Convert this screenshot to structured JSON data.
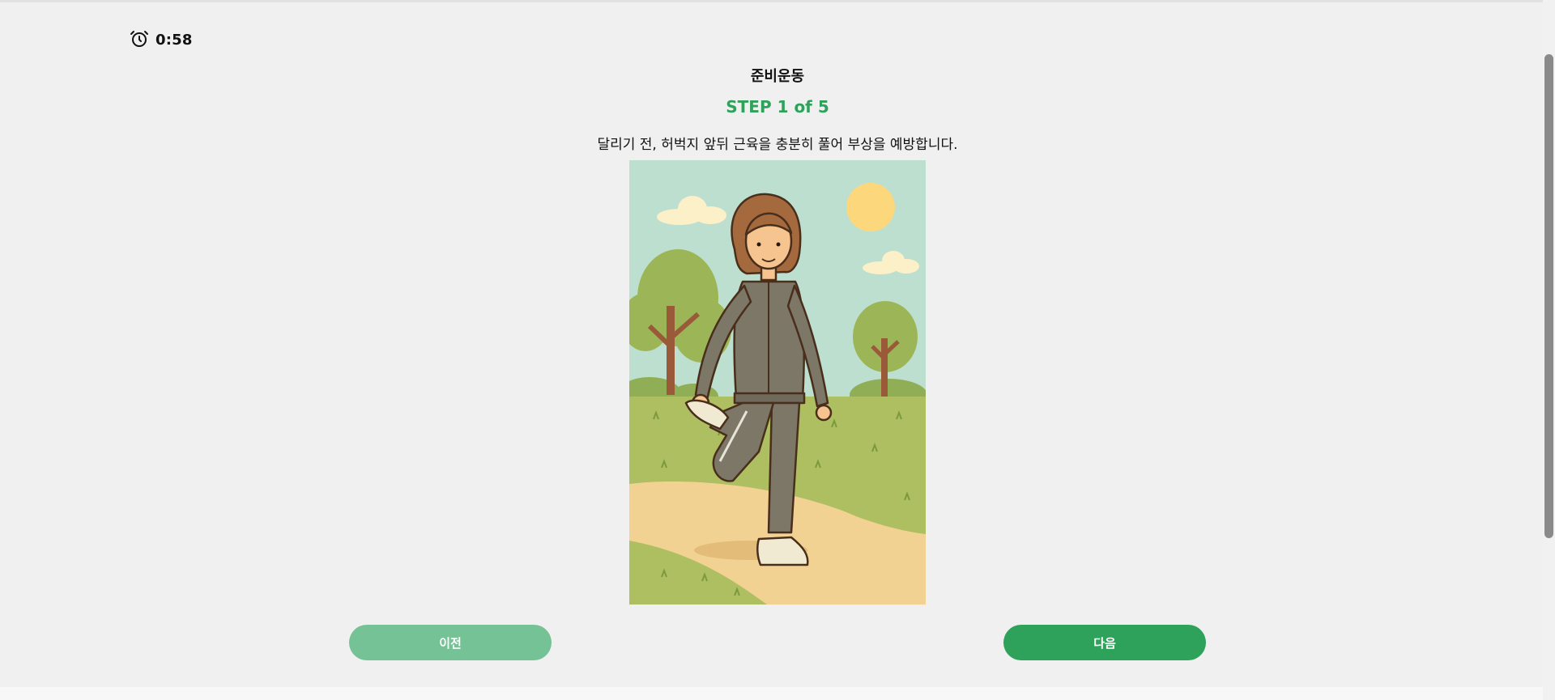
{
  "timer": {
    "icon": "alarm-clock-icon",
    "value": "0:58"
  },
  "header": {
    "title": "준비운동",
    "step_label": "STEP 1 of 5",
    "description": "달리기 전, 허벅지 앞뒤 근육을 충분히 풀어 부상을 예방합니다."
  },
  "illustration": {
    "subject": "woman-stretching-quadriceps-in-park"
  },
  "navigation": {
    "prev_label": "이전",
    "next_label": "다음"
  },
  "colors": {
    "accent": "#2ea15a",
    "prev_button": "#75c296",
    "next_button": "#2ea15a",
    "panel_background": "#f0f0f0"
  }
}
